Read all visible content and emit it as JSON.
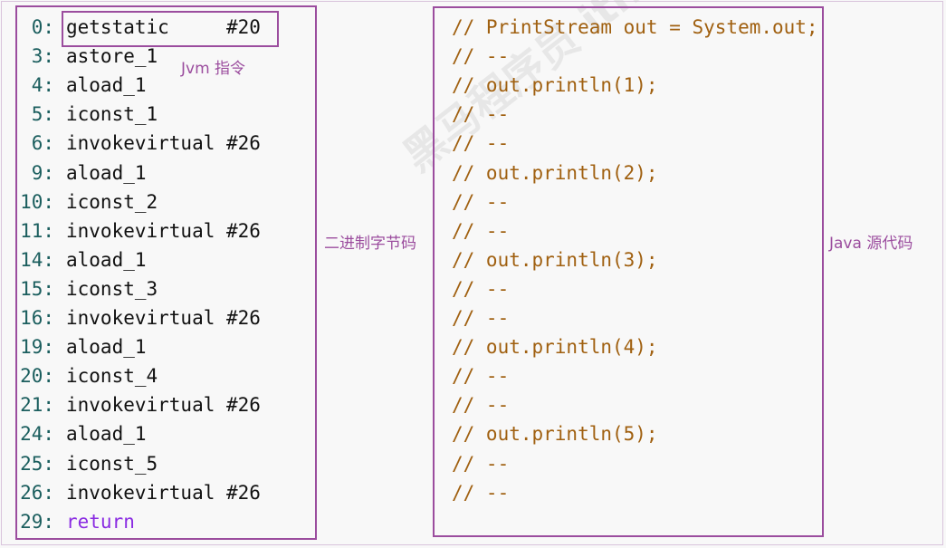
{
  "annotations": {
    "jvm_instruction_label": "Jvm 指令",
    "bytecode_label": "二进制字节码",
    "source_label": "Java 源代码"
  },
  "watermark": {
    "text": "黑马程序员 itheima.com"
  },
  "bytecode": [
    {
      "offset": "0:",
      "instruction": "getstatic     #20"
    },
    {
      "offset": "3:",
      "instruction": "astore_1"
    },
    {
      "offset": "4:",
      "instruction": "aload_1"
    },
    {
      "offset": "5:",
      "instruction": "iconst_1"
    },
    {
      "offset": "6:",
      "instruction": "invokevirtual #26"
    },
    {
      "offset": "9:",
      "instruction": "aload_1"
    },
    {
      "offset": "10:",
      "instruction": "iconst_2"
    },
    {
      "offset": "11:",
      "instruction": "invokevirtual #26"
    },
    {
      "offset": "14:",
      "instruction": "aload_1"
    },
    {
      "offset": "15:",
      "instruction": "iconst_3"
    },
    {
      "offset": "16:",
      "instruction": "invokevirtual #26"
    },
    {
      "offset": "19:",
      "instruction": "aload_1"
    },
    {
      "offset": "20:",
      "instruction": "iconst_4"
    },
    {
      "offset": "21:",
      "instruction": "invokevirtual #26"
    },
    {
      "offset": "24:",
      "instruction": "aload_1"
    },
    {
      "offset": "25:",
      "instruction": "iconst_5"
    },
    {
      "offset": "26:",
      "instruction": "invokevirtual #26"
    },
    {
      "offset": "29:",
      "instruction": "return"
    }
  ],
  "source": [
    "// PrintStream out = System.out;",
    "// --",
    "// out.println(1);",
    "// --",
    "// --",
    "// out.println(2);",
    "// --",
    "// --",
    "// out.println(3);",
    "// --",
    "// --",
    "// out.println(4);",
    "// --",
    "// --",
    "// out.println(5);",
    "// --",
    "// --"
  ],
  "colors": {
    "frame": "#9b4d9e",
    "offset": "#1b5e5e",
    "comment": "#a06010",
    "keyword": "#8a2be2"
  }
}
